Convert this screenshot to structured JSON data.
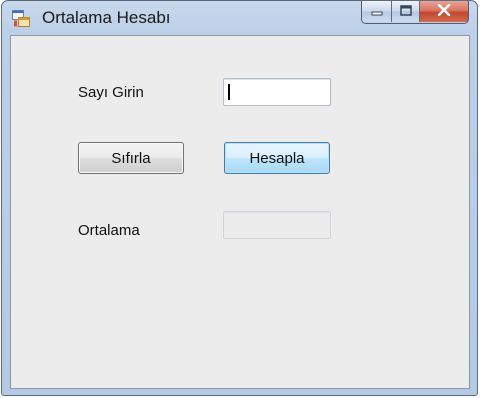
{
  "window": {
    "title": "Ortalama Hesabı",
    "controls": [
      "minimize-icon",
      "maximize-icon",
      "close-icon"
    ]
  },
  "form": {
    "input_label": "Sayı Girin",
    "input_value": "",
    "reset_button": "Sıfırla",
    "calc_button": "Hesapla",
    "result_label": "Ortalama",
    "result_value": ""
  },
  "colors": {
    "close_button": "#c2452c",
    "focused_button_border": "#3c7fb1",
    "client_background": "#ececec"
  }
}
